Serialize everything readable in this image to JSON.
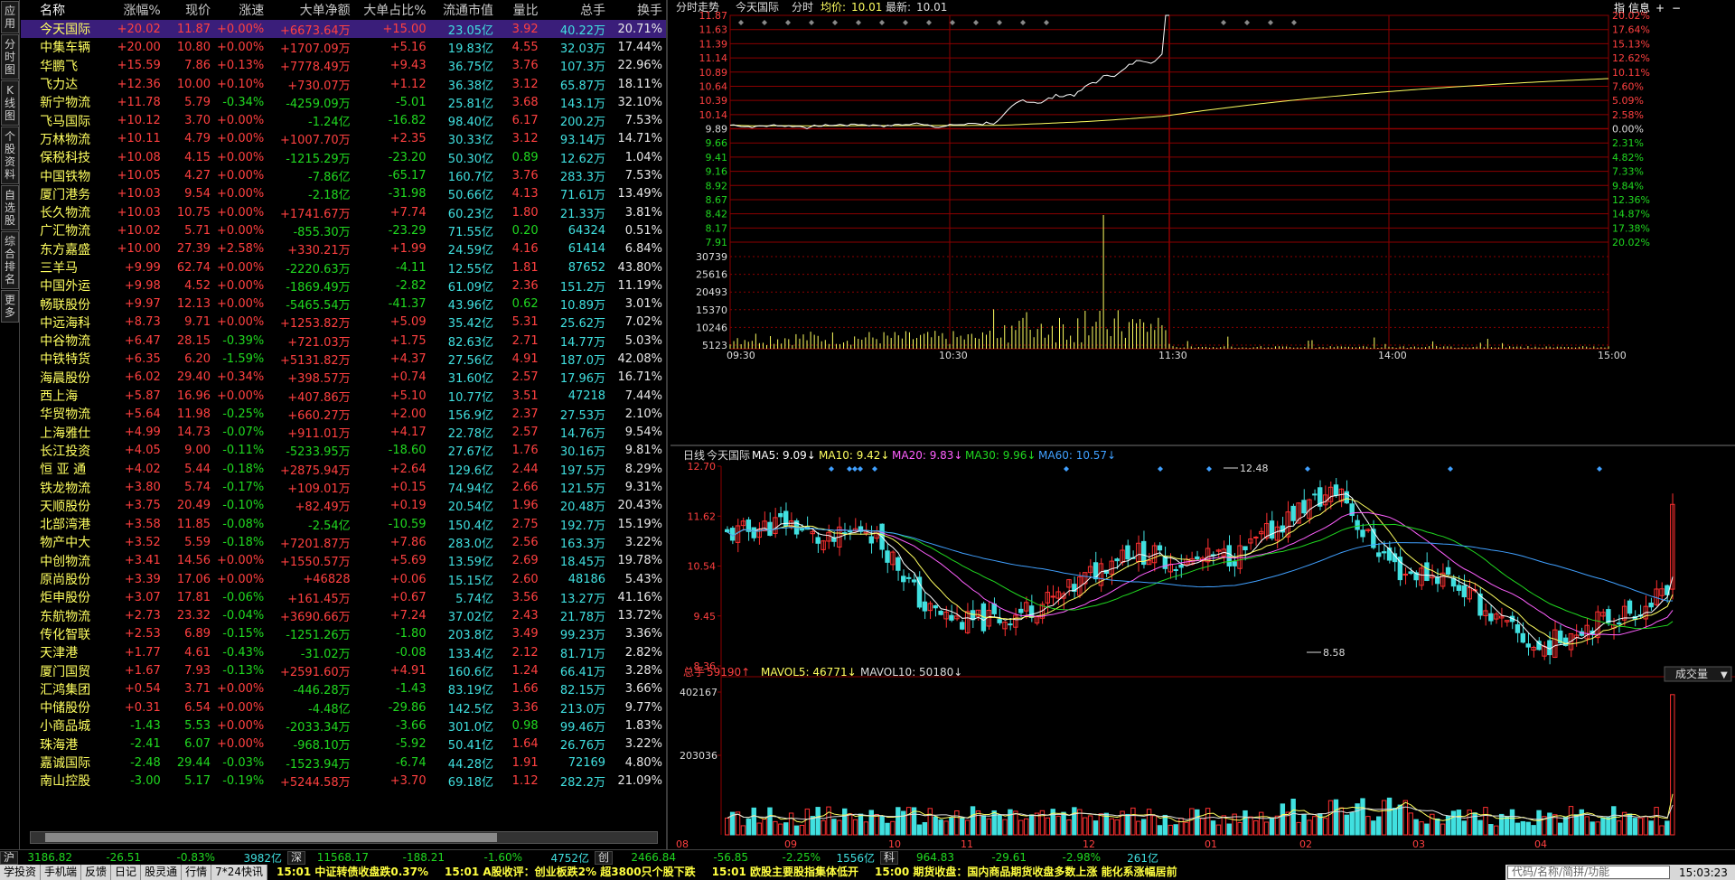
{
  "side_tabs": [
    {
      "label": "应用",
      "active": false
    },
    {
      "label": "分时图",
      "active": false
    },
    {
      "label": "K线图",
      "active": false
    },
    {
      "label": "个股资料",
      "active": false
    },
    {
      "label": "自选股",
      "active": false
    },
    {
      "label": "综合排名",
      "active": false
    },
    {
      "label": "更多",
      "active": false
    }
  ],
  "list_headers": [
    "",
    "名称",
    "涨幅%",
    "现价",
    "涨速",
    "大单净额",
    "大单占比%",
    "流通市值",
    "量比",
    "总手",
    "换手"
  ],
  "stocks": [
    [
      "今天国际",
      "+20.02",
      "11.87",
      "+0.00%",
      "+6673.64万",
      "+15.00",
      "23.05亿",
      "3.92",
      "40.22万",
      "20.71%"
    ],
    [
      "中集车辆",
      "+20.00",
      "10.80",
      "+0.00%",
      "+1707.09万",
      "+5.16",
      "19.83亿",
      "4.55",
      "32.03万",
      "17.44%"
    ],
    [
      "华鹏飞",
      "+15.59",
      "7.86",
      "+0.13%",
      "+7778.49万",
      "+9.43",
      "36.75亿",
      "3.76",
      "107.3万",
      "22.96%"
    ],
    [
      "飞力达",
      "+12.36",
      "10.00",
      "+0.10%",
      "+730.07万",
      "+1.12",
      "36.38亿",
      "3.12",
      "65.87万",
      "18.11%"
    ],
    [
      "新宁物流",
      "+11.78",
      "5.79",
      "-0.34%",
      "-4259.09万",
      "-5.01",
      "25.81亿",
      "3.68",
      "143.1万",
      "32.10%"
    ],
    [
      "飞马国际",
      "+10.12",
      "3.70",
      "+0.00%",
      "-1.24亿",
      "-16.82",
      "98.40亿",
      "6.17",
      "200.2万",
      "7.53%"
    ],
    [
      "万林物流",
      "+10.11",
      "4.79",
      "+0.00%",
      "+1007.70万",
      "+2.35",
      "30.33亿",
      "3.12",
      "93.14万",
      "14.71%"
    ],
    [
      "保税科技",
      "+10.08",
      "4.15",
      "+0.00%",
      "-1215.29万",
      "-23.20",
      "50.30亿",
      "0.89",
      "12.62万",
      "1.04%"
    ],
    [
      "中国铁物",
      "+10.05",
      "4.27",
      "+0.00%",
      "-7.86亿",
      "-65.17",
      "160.7亿",
      "3.76",
      "283.3万",
      "7.53%"
    ],
    [
      "厦门港务",
      "+10.03",
      "9.54",
      "+0.00%",
      "-2.18亿",
      "-31.98",
      "50.66亿",
      "4.13",
      "71.61万",
      "13.49%"
    ],
    [
      "长久物流",
      "+10.03",
      "10.75",
      "+0.00%",
      "+1741.67万",
      "+7.74",
      "60.23亿",
      "1.80",
      "21.33万",
      "3.81%"
    ],
    [
      "广汇物流",
      "+10.02",
      "5.71",
      "+0.00%",
      "-855.30万",
      "-23.29",
      "71.55亿",
      "0.20",
      "64324",
      "0.51%"
    ],
    [
      "东方嘉盛",
      "+10.00",
      "27.39",
      "+2.58%",
      "+330.21万",
      "+1.99",
      "24.59亿",
      "4.16",
      "61414",
      "6.84%"
    ],
    [
      "三羊马",
      "+9.99",
      "62.74",
      "+0.00%",
      "-2220.63万",
      "-4.11",
      "12.55亿",
      "1.81",
      "87652",
      "43.80%"
    ],
    [
      "中国外运",
      "+9.98",
      "4.52",
      "+0.00%",
      "-1869.49万",
      "-2.82",
      "61.09亿",
      "2.36",
      "151.2万",
      "11.19%"
    ],
    [
      "畅联股份",
      "+9.97",
      "12.13",
      "+0.00%",
      "-5465.54万",
      "-41.37",
      "43.96亿",
      "0.62",
      "10.89万",
      "3.01%"
    ],
    [
      "中远海科",
      "+8.73",
      "9.71",
      "+0.00%",
      "+1253.82万",
      "+5.09",
      "35.42亿",
      "5.31",
      "25.62万",
      "7.02%"
    ],
    [
      "中谷物流",
      "+6.47",
      "28.15",
      "-0.39%",
      "+721.03万",
      "+1.75",
      "82.63亿",
      "2.71",
      "14.77万",
      "5.03%"
    ],
    [
      "中铁特货",
      "+6.35",
      "6.20",
      "-1.59%",
      "+5131.82万",
      "+4.37",
      "27.56亿",
      "4.91",
      "187.0万",
      "42.08%"
    ],
    [
      "海晨股份",
      "+6.02",
      "29.40",
      "+0.34%",
      "+398.57万",
      "+0.74",
      "31.60亿",
      "2.57",
      "17.96万",
      "16.71%"
    ],
    [
      "西上海",
      "+5.87",
      "16.96",
      "+0.00%",
      "+407.86万",
      "+5.10",
      "10.77亿",
      "3.51",
      "47218",
      "7.44%"
    ],
    [
      "华贸物流",
      "+5.64",
      "11.98",
      "-0.25%",
      "+660.27万",
      "+2.00",
      "156.9亿",
      "2.37",
      "27.53万",
      "2.10%"
    ],
    [
      "上海雅仕",
      "+4.99",
      "14.73",
      "-0.07%",
      "+911.01万",
      "+4.17",
      "22.78亿",
      "2.57",
      "14.76万",
      "9.54%"
    ],
    [
      "长江投资",
      "+4.05",
      "9.00",
      "-0.11%",
      "-5233.95万",
      "-18.60",
      "27.67亿",
      "1.76",
      "30.16万",
      "9.81%"
    ],
    [
      "恒 亚 通",
      "+4.02",
      "5.44",
      "-0.18%",
      "+2875.94万",
      "+2.64",
      "129.6亿",
      "2.44",
      "197.5万",
      "8.29%"
    ],
    [
      "铁龙物流",
      "+3.80",
      "5.74",
      "-0.17%",
      "+109.01万",
      "+0.15",
      "74.94亿",
      "2.66",
      "121.5万",
      "9.31%"
    ],
    [
      "天顺股份",
      "+3.75",
      "20.49",
      "-0.10%",
      "+82.49万",
      "+0.19",
      "20.54亿",
      "1.96",
      "20.48万",
      "20.43%"
    ],
    [
      "北部湾港",
      "+3.58",
      "11.85",
      "-0.08%",
      "-2.54亿",
      "-10.59",
      "150.4亿",
      "2.75",
      "192.7万",
      "15.19%"
    ],
    [
      "物产中大",
      "+3.52",
      "5.59",
      "-0.18%",
      "+7201.87万",
      "+7.86",
      "283.0亿",
      "2.56",
      "163.3万",
      "3.22%"
    ],
    [
      "中创物流",
      "+3.41",
      "14.56",
      "+0.00%",
      "+1550.57万",
      "+5.69",
      "13.59亿",
      "2.69",
      "18.45万",
      "19.78%"
    ],
    [
      "原尚股份",
      "+3.39",
      "17.06",
      "+0.00%",
      "+46828",
      "+0.06",
      "15.15亿",
      "2.60",
      "48186",
      "5.43%"
    ],
    [
      "炬申股份",
      "+3.07",
      "17.81",
      "-0.06%",
      "+161.45万",
      "+0.67",
      "5.74亿",
      "3.56",
      "13.27万",
      "41.16%"
    ],
    [
      "东航物流",
      "+2.73",
      "23.32",
      "-0.04%",
      "+3690.66万",
      "+7.24",
      "37.02亿",
      "2.43",
      "21.78万",
      "13.72%"
    ],
    [
      "传化智联",
      "+2.53",
      "6.89",
      "-0.15%",
      "-1251.26万",
      "-1.80",
      "203.8亿",
      "3.49",
      "99.23万",
      "3.36%"
    ],
    [
      "天津港",
      "+1.77",
      "4.61",
      "-0.43%",
      "-31.02万",
      "-0.08",
      "133.4亿",
      "2.12",
      "81.71万",
      "2.82%"
    ],
    [
      "厦门国贸",
      "+1.67",
      "7.93",
      "-0.13%",
      "+2591.60万",
      "+4.91",
      "160.6亿",
      "1.24",
      "66.41万",
      "3.28%"
    ],
    [
      "汇鸿集团",
      "+0.54",
      "3.71",
      "+0.00%",
      "-446.28万",
      "-1.43",
      "83.19亿",
      "1.66",
      "82.15万",
      "3.66%"
    ],
    [
      "中储股份",
      "+0.31",
      "6.54",
      "+0.00%",
      "-4.48亿",
      "-29.86",
      "142.5亿",
      "3.36",
      "213.0万",
      "9.77%"
    ],
    [
      "小商品城",
      "-1.43",
      "5.53",
      "+0.00%",
      "-2033.34万",
      "-3.66",
      "301.0亿",
      "0.98",
      "99.46万",
      "1.83%"
    ],
    [
      "珠海港",
      "-2.41",
      "6.07",
      "+0.00%",
      "-968.10万",
      "-5.92",
      "50.41亿",
      "1.64",
      "26.76万",
      "3.22%"
    ],
    [
      "嘉诚国际",
      "-2.48",
      "29.44",
      "-0.03%",
      "-1523.94万",
      "-6.74",
      "44.28亿",
      "1.91",
      "72169",
      "4.80%"
    ],
    [
      "南山控股",
      "-3.00",
      "5.17",
      "-0.19%",
      "+5244.58万",
      "+3.70",
      "69.18亿",
      "1.12",
      "282.2万",
      "21.09%"
    ]
  ],
  "intraday": {
    "title": "分时走势",
    "stock": "今天国际",
    "mode": "分时",
    "avg_label": "均价:",
    "avg": "10.01",
    "last_label": "最新:",
    "last": "10.01",
    "buttons": [
      "指",
      "信息",
      "+",
      "−"
    ],
    "price_ticks": [
      "11.87",
      "11.63",
      "11.39",
      "11.14",
      "10.89",
      "10.64",
      "10.39",
      "10.14",
      "9.89",
      "9.66",
      "9.41",
      "9.16",
      "8.92",
      "8.67",
      "8.42",
      "8.17",
      "7.91"
    ],
    "pct_ticks": [
      "20.02%",
      "17.64%",
      "15.13%",
      "12.62%",
      "10.11%",
      "7.60%",
      "5.09%",
      "2.58%",
      "0.00%",
      "2.31%",
      "4.82%",
      "7.33%",
      "9.84%",
      "12.36%",
      "14.87%",
      "17.38%",
      "20.02%"
    ],
    "vol_ticks": [
      "30739",
      "25616",
      "20493",
      "15370",
      "10246",
      "5123"
    ],
    "time_ticks": [
      "09:30",
      "10:30",
      "11:30",
      "14:00",
      "15:00"
    ],
    "colors": {
      "price": "#ffffff",
      "avg": "#ffff60",
      "grid": "#8b0000"
    }
  },
  "kline": {
    "title": "日线",
    "stock": "今天国际",
    "ma": [
      {
        "label": "MA5: 9.09↓",
        "color": "#ffffff"
      },
      {
        "label": "MA10: 9.42↓",
        "color": "#ffff60"
      },
      {
        "label": "MA20: 9.83↓",
        "color": "#ff60ff"
      },
      {
        "label": "MA30: 9.96↓",
        "color": "#20d820"
      },
      {
        "label": "MA60: 10.57↓",
        "color": "#40a0ff"
      }
    ],
    "price_ticks": [
      "12.70",
      "11.62",
      "10.54",
      "9.45",
      "8.36"
    ],
    "high_label": "12.48",
    "low_label": "8.58",
    "vol_title": "总手",
    "vol_val": "59190↑",
    "mavol5": "MAVOL5: 46771↓",
    "mavol10": "MAVOL10: 50180↓",
    "vol_ticks": [
      "402167",
      "203036"
    ],
    "vol_select": "成交量",
    "date_ticks": [
      "08",
      "09",
      "10",
      "11",
      "12",
      "01",
      "02",
      "03",
      "04"
    ],
    "colors": {
      "up": "#ff3030",
      "down": "#40e0e0"
    }
  },
  "index_bar": [
    {
      "label": "沪",
      "value": "3186.82",
      "change": "-26.51",
      "pct": "-0.83%",
      "amount": "3982亿"
    },
    {
      "label": "深",
      "value": "11568.17",
      "change": "-188.21",
      "pct": "-1.60%",
      "amount": "4752亿"
    },
    {
      "label": "创",
      "value": "2466.84",
      "change": "-56.85",
      "pct": "-2.25%",
      "amount": "1556亿"
    },
    {
      "label": "科",
      "value": "964.83",
      "change": "-29.61",
      "pct": "-2.98%",
      "amount": "261亿"
    }
  ],
  "status_buttons": [
    "学投资",
    "手机端",
    "反馈",
    "日记",
    "股灵通",
    "行情",
    "7*24快讯"
  ],
  "ticker": [
    "15:01 中证转债收盘跌0.37%",
    "15:01 A股收评：创业板跌2% 超3800只个股下跌",
    "15:01 欧股主要股指集体低开",
    "15:00 期货收盘：国内商品期货收盘多数上涨 能化系涨幅居前"
  ],
  "search_placeholder": "代码/名称/简拼/功能",
  "clock": "15:03:23"
}
